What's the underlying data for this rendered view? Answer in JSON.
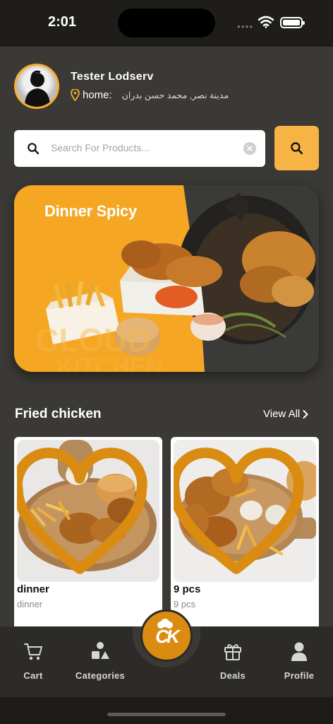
{
  "status_bar": {
    "time": "2:01",
    "signal_icon": "signal-dots-icon",
    "wifi_icon": "wifi-icon",
    "battery_icon": "battery-icon"
  },
  "user": {
    "name": "Tester Lodserv",
    "address_label": "home:",
    "address_value": "مدينة نصر, محمد حسن بدران",
    "location_icon": "location-pin-icon"
  },
  "search": {
    "placeholder": "Search For Products...",
    "button_icon": "search-icon",
    "clear_icon": "clear-icon"
  },
  "banner": {
    "title": "Dinner Spicy"
  },
  "section": {
    "title": "Fried chicken",
    "view_all": "View All"
  },
  "products": [
    {
      "name": "dinner",
      "subtitle": "dinner",
      "favorite_icon": "heart-icon"
    },
    {
      "name": "9 pcs",
      "subtitle": "9 pcs",
      "favorite_icon": "heart-icon"
    }
  ],
  "tab_bar": {
    "cart": "Cart",
    "categories": "Categories",
    "logo": "CK",
    "deals": "Deals",
    "profile": "Profile"
  },
  "colors": {
    "accent": "#f7b344",
    "accent_dark": "#d98c11",
    "background": "#3b3935",
    "tab_bar": "#2d2b28"
  }
}
